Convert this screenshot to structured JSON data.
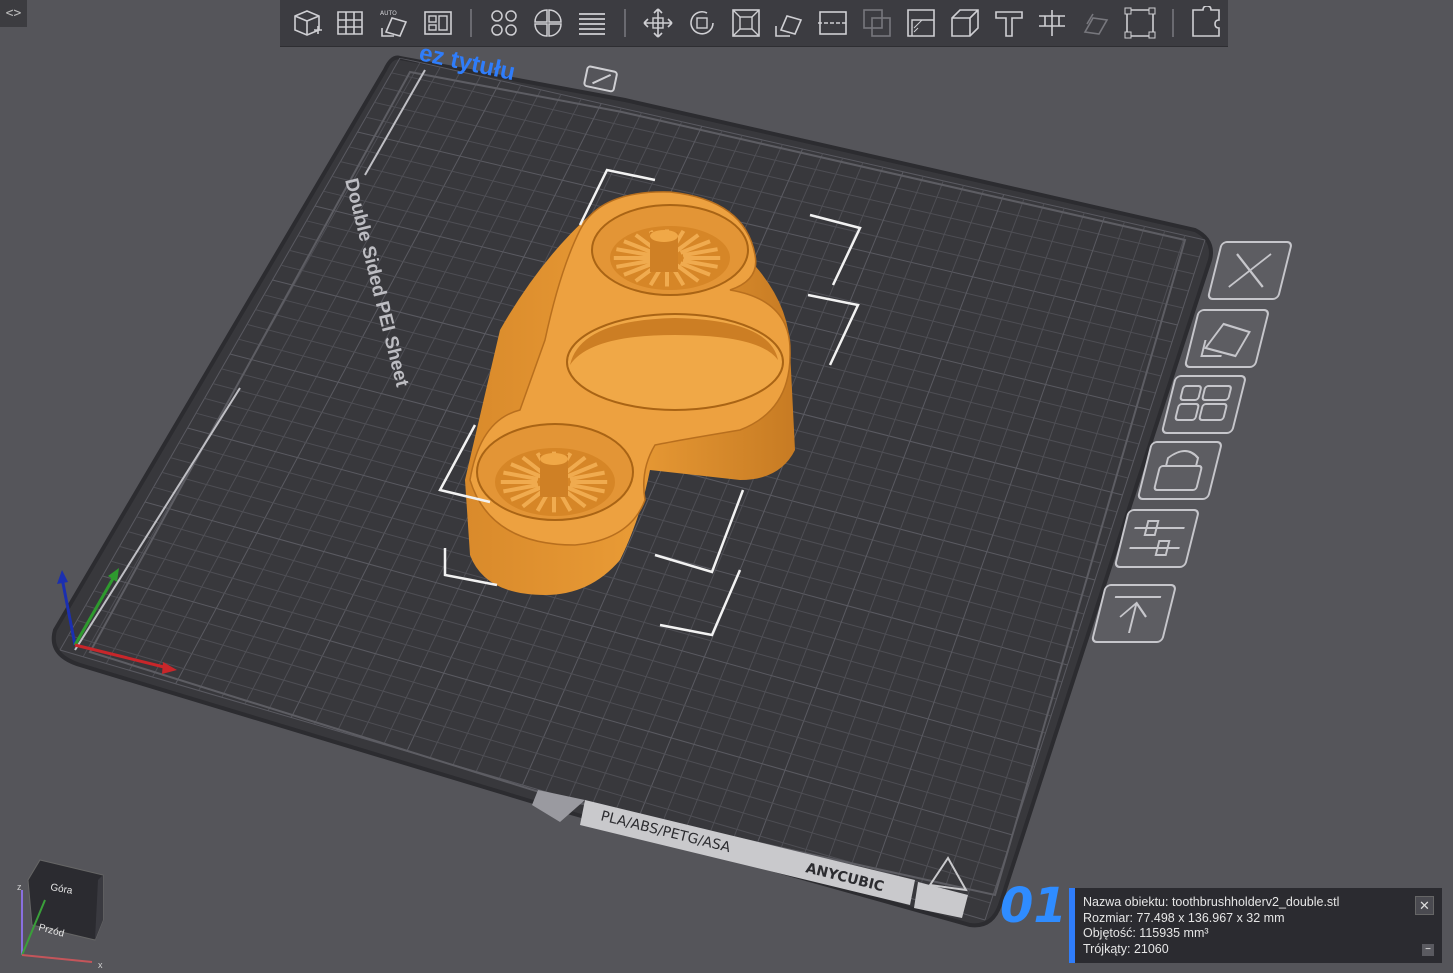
{
  "window": {
    "expand_glyph": "<>"
  },
  "toolbar": {
    "groups": [
      [
        "add-object-icon",
        "grid-icon",
        "auto-arrange-icon",
        "arrange-icon"
      ],
      [
        "split-objects-icon",
        "split-parts-icon",
        "layers-icon"
      ],
      [
        "move-icon",
        "rotate-icon",
        "scale-icon",
        "lay-on-face-icon",
        "cut-icon",
        "mesh-boolean-icon",
        "support-paint-icon",
        "seam-paint-icon",
        "text-icon",
        "measure-icon",
        "assembly-icon",
        "variable-layer-icon"
      ],
      [
        "puzzle-icon"
      ]
    ]
  },
  "plate": {
    "title": "ez tytułu",
    "sheet_label": "Double Sided PEI Sheet",
    "materials": "PLA/ABS/PETG/ASA",
    "brand": "ANYCUBIC",
    "number": "01"
  },
  "plate_tools": [
    "close-icon",
    "auto-orient-icon",
    "arrange-plate-icon",
    "lock-icon",
    "settings-icon",
    "move-to-top-icon"
  ],
  "view_cube": {
    "top": "Góra",
    "front": "Przód",
    "axis_x": "x",
    "axis_z": "z"
  },
  "object_info": {
    "name_label": "Nazwa obiektu:",
    "name_value": "toothbrushholderv2_double.stl",
    "size_label": "Rozmiar:",
    "size_value": "77.498 x 136.967 x 32 mm",
    "volume_label": "Objętość:",
    "volume_value": "115935 mm³",
    "triangles_label": "Trójkąty:",
    "triangles_value": "21060",
    "close_glyph": "✕",
    "minimize_glyph": "−"
  },
  "colors": {
    "background": "#55555a",
    "plate": "#38383c",
    "grid": "#4e4e54",
    "model": "#e8952f",
    "accent": "#2f7dfb"
  }
}
